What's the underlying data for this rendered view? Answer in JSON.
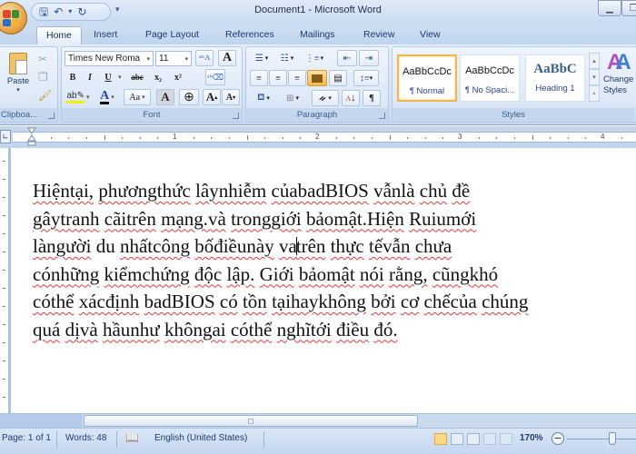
{
  "window": {
    "title": "Document1 - Microsoft Word",
    "qat": {
      "save_icon": "save-icon",
      "undo_icon": "undo-icon",
      "redo_icon": "redo-icon"
    },
    "controls": [
      "minimize",
      "restore"
    ]
  },
  "tabs": [
    {
      "label": "Home",
      "active": true
    },
    {
      "label": "Insert"
    },
    {
      "label": "Page Layout"
    },
    {
      "label": "References"
    },
    {
      "label": "Mailings"
    },
    {
      "label": "Review"
    },
    {
      "label": "View"
    }
  ],
  "ribbon": {
    "clipboard": {
      "label": "Clipboa...",
      "paste": "Paste"
    },
    "font": {
      "label": "Font",
      "font_name": "Times New Roma",
      "font_size": "11",
      "bold": "B",
      "italic": "I",
      "underline": "U",
      "strike": "abc",
      "subscript": "x₂",
      "superscript": "x²",
      "change_case": "Aa",
      "grow": "A",
      "shrink": "A",
      "char_shading": "A",
      "font_color": "A"
    },
    "paragraph": {
      "label": "Paragraph",
      "show_marks": "¶"
    },
    "styles": {
      "label": "Styles",
      "items": [
        {
          "sample": "AaBbCcDc",
          "name": "¶ Normal",
          "selected": true
        },
        {
          "sample": "AaBbCcDc",
          "name": "¶ No Spaci..."
        },
        {
          "sample": "AaBbC",
          "name": "Heading 1"
        }
      ],
      "change_styles": "Change Styles"
    }
  },
  "ruler": {
    "numbers": [
      "1",
      "2",
      "3",
      "4"
    ]
  },
  "document": {
    "lines": [
      [
        [
          "Hiệntại,",
          true
        ],
        [
          "phươngthức",
          true
        ],
        [
          "lâynhiễm",
          true
        ],
        [
          "củabadBIOS",
          true
        ],
        [
          "vẫnlà",
          true
        ],
        [
          "chủ",
          true
        ],
        [
          "đề",
          true
        ]
      ],
      [
        [
          "gâytranh",
          true
        ],
        [
          "cãitrên",
          true
        ],
        [
          "mạng.và",
          true
        ],
        [
          "tronggiới",
          true
        ],
        [
          "bảomật.Hiện",
          true
        ],
        [
          "Ruiumới",
          true
        ]
      ],
      [
        [
          "làngười",
          true
        ],
        [
          "du",
          false
        ],
        [
          "nhấtcông",
          true
        ],
        [
          "bốđiềunày",
          true
        ],
        [
          "vàtrên",
          true
        ],
        [
          "thực",
          true
        ],
        [
          "tếvẫn",
          true
        ],
        [
          "chưa",
          true
        ]
      ],
      [
        [
          "cónhững",
          true
        ],
        [
          "kiểmchứng",
          true
        ],
        [
          "độc",
          true
        ],
        [
          "lập.",
          true
        ],
        [
          "Giới",
          true
        ],
        [
          "bảomật",
          true
        ],
        [
          "nói",
          true
        ],
        [
          "rằng,",
          true
        ],
        [
          "cũngkhó",
          true
        ]
      ],
      [
        [
          "cóthể",
          true
        ],
        [
          "xácđịnh",
          true
        ],
        [
          "badBIOS",
          true
        ],
        [
          "có",
          true
        ],
        [
          "tồn",
          true
        ],
        [
          "tạihaykhông",
          true
        ],
        [
          "bởi",
          true
        ],
        [
          "cơ",
          true
        ],
        [
          "chếcủa",
          true
        ],
        [
          "chúng",
          true
        ]
      ],
      [
        [
          "quá",
          true
        ],
        [
          "dịvà",
          true
        ],
        [
          "hầunhư",
          true
        ],
        [
          "khôngai",
          true
        ],
        [
          "cóthể",
          true
        ],
        [
          "nghĩtới",
          true
        ],
        [
          "điều",
          true
        ],
        [
          "đó.",
          true
        ]
      ]
    ]
  },
  "statusbar": {
    "page": "Page: 1 of 1",
    "words": "Words: 48",
    "language": "English (United States)",
    "zoom": "170%",
    "active_view": "Print Layout"
  }
}
